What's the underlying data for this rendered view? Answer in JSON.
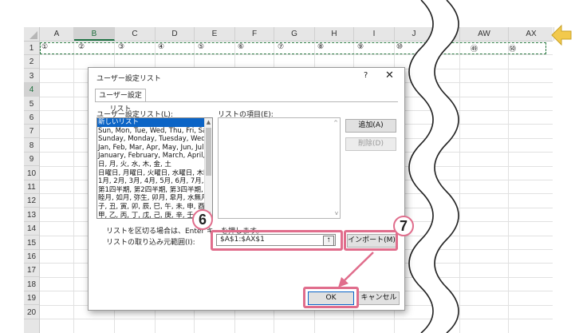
{
  "sheet": {
    "columns": [
      "A",
      "B",
      "C",
      "D",
      "E",
      "F",
      "G",
      "H",
      "I",
      "J",
      "AV",
      "AW",
      "AX"
    ],
    "selected_column": "B",
    "rows": [
      "1",
      "2",
      "3",
      "4",
      "5",
      "6",
      "7",
      "8",
      "9",
      "10",
      "11",
      "12",
      "13",
      "14",
      "15",
      "16",
      "17",
      "18",
      "19",
      "20"
    ],
    "selected_row": "4",
    "row1_values": [
      "①",
      "②",
      "③",
      "④",
      "⑤",
      "⑥",
      "⑦",
      "⑧",
      "⑨",
      "⑩",
      "㊾",
      "㊿"
    ]
  },
  "dialog": {
    "title": "ユーザー設定リスト",
    "help": "?",
    "close": "✕",
    "tab": "ユーザー設定リスト",
    "lists_label": "ユーザー設定リスト(L):",
    "entries_label": "リストの項目(E):",
    "lists": [
      "新しいリスト",
      "Sun, Mon, Tue, Wed, Thu, Fri, Sa",
      "Sunday, Monday, Tuesday, Wedn",
      "Jan, Feb, Mar, Apr, May, Jun, Jul,",
      "January, February, March, April, M",
      "日, 月, 火, 水, 木, 金, 土",
      "日曜日, 月曜日, 火曜日, 水曜日, 木曜",
      "1月, 2月, 3月, 4月, 5月, 6月, 7月, 8",
      "第1四半期, 第2四半期, 第3四半期, 第",
      "睦月, 如月, 弥生, 卯月, 皐月, 水無月,",
      "子, 丑, 寅, 卯, 辰, 巳, 午, 未, 申, 酉",
      "甲, 乙, 丙, 丁, 戊, 己, 庚, 辛, 壬, 癸"
    ],
    "add_button": "追加(A)",
    "delete_button": "削除(D)",
    "hint_text": "リストを区切る場合は、Enter キーを押します。",
    "import_label": "リストの取り込み元範囲(I):",
    "import_range": "$A$1:$AX$1",
    "import_button": "インポート(M)",
    "ok_button": "OK",
    "cancel_button": "キャンセル"
  },
  "annotations": {
    "step6": "6",
    "step7": "7",
    "highlight_color": "#e06d8c"
  }
}
